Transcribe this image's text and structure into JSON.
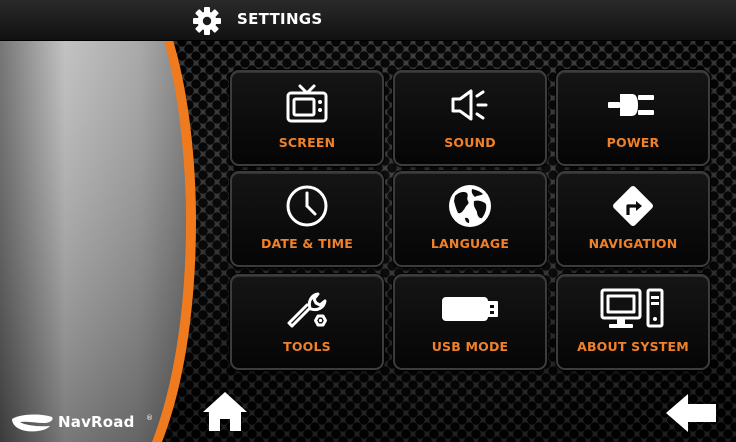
{
  "header": {
    "title": "SETTINGS",
    "icon": "gear-icon"
  },
  "tiles": [
    {
      "label": "SCREEN",
      "icon": "tv-icon"
    },
    {
      "label": "SOUND",
      "icon": "speaker-icon"
    },
    {
      "label": "POWER",
      "icon": "plug-icon"
    },
    {
      "label": "DATE & TIME",
      "icon": "clock-icon"
    },
    {
      "label": "LANGUAGE",
      "icon": "globe-icon"
    },
    {
      "label": "NAVIGATION",
      "icon": "direction-sign-icon"
    },
    {
      "label": "TOOLS",
      "icon": "wrench-icon"
    },
    {
      "label": "USB MODE",
      "icon": "usb-drive-icon"
    },
    {
      "label": "ABOUT SYSTEM",
      "icon": "computer-icon"
    }
  ],
  "footer": {
    "home_icon": "home-icon",
    "back_icon": "back-arrow-icon"
  },
  "brand": {
    "name": "NavRoad",
    "mark": "®"
  },
  "colors": {
    "accent": "#f0812a",
    "header_text": "#ffffff",
    "panel_silver": "#a9a9a9"
  }
}
